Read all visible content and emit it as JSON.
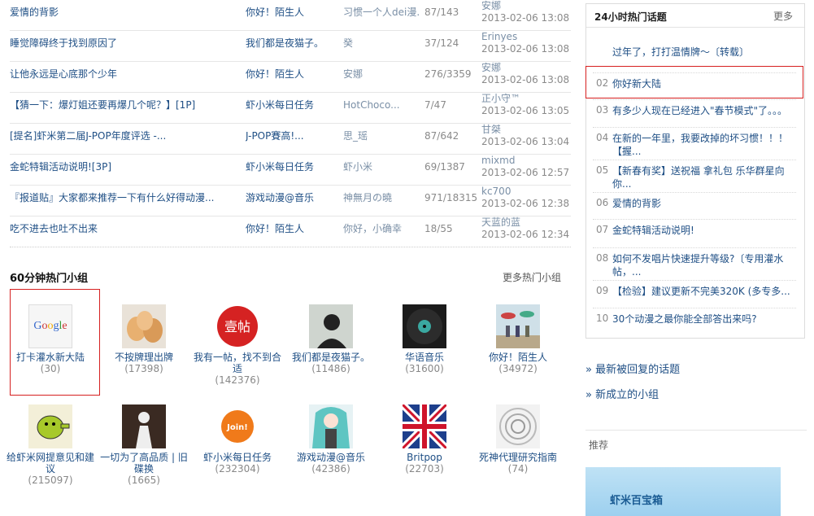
{
  "topics": [
    {
      "title": "爱情的背影",
      "group": "你好！陌生人",
      "author": "习惯一个人dei漫...",
      "count": "87/143",
      "last_user": "安娜",
      "last_time": "2013-02-06 13:08"
    },
    {
      "title": "睡觉障碍终于找到原因了",
      "group": "我们都是夜猫子。",
      "author": "癸",
      "count": "37/124",
      "last_user": "Erinyes",
      "last_time": "2013-02-06 13:08"
    },
    {
      "title": "让他永远是心底那个少年",
      "group": "你好！陌生人",
      "author": "安娜",
      "count": "276/3359",
      "last_user": "安娜",
      "last_time": "2013-02-06 13:08"
    },
    {
      "title": "【猜一下：爆灯姐还要再爆几个呢？】[1P]",
      "group": "虾小米每日任务",
      "author": "HotChoco...",
      "count": "7/47",
      "last_user": "正小守™",
      "last_time": "2013-02-06 13:05"
    },
    {
      "title": "[提名]虾米第二届J-POP年度评选 -...",
      "group": "J-POP賽高!...",
      "author": "思_瑶",
      "count": "87/642",
      "last_user": "甘桀",
      "last_time": "2013-02-06 13:04"
    },
    {
      "title": "金蛇特辑活动说明![3P]",
      "group": "虾小米每日任务",
      "author": "虾小米",
      "count": "69/1387",
      "last_user": "mixmd",
      "last_time": "2013-02-06 12:57"
    },
    {
      "title": "『报道贴』大家都来推荐一下有什么好得动漫...",
      "group": "游戏动漫@音乐",
      "author": "神無月の曉",
      "count": "971/18315",
      "last_user": "kc700",
      "last_time": "2013-02-06 12:38"
    },
    {
      "title": "吃不进去也吐不出来",
      "group": "你好！陌生人",
      "author": "你好，小确幸",
      "count": "18/55",
      "last_user": "天蓝的蓝",
      "last_time": "2013-02-06 12:34"
    }
  ],
  "groups_section": {
    "title": "60分钟热门小组",
    "more": "更多热门小组"
  },
  "groups": [
    {
      "name": "打卡灌水新大陆",
      "count": "(30)",
      "icon": "google-logo-icon",
      "logo_text": "Google"
    },
    {
      "name": "不按牌理出牌",
      "count": "(17398)",
      "icon": "eggs-icon"
    },
    {
      "name": "我有一帖，找不到合适",
      "count": "(142376)",
      "icon": "red-seal-icon",
      "logo_text": "壹帖"
    },
    {
      "name": "我们都是夜猫子。",
      "count": "(11486)",
      "icon": "person-silhouette-icon"
    },
    {
      "name": "华语音乐",
      "count": "(31600)",
      "icon": "vinyl-record-icon"
    },
    {
      "name": "你好！陌生人",
      "count": "(34972)",
      "icon": "people-umbrellas-icon"
    },
    {
      "name": "给虾米网提意见和建议",
      "count": "(215097)",
      "icon": "doodle-jump-icon"
    },
    {
      "name": "一切为了高品质 | 旧碟换",
      "count": "(1665)",
      "icon": "white-figure-icon"
    },
    {
      "name": "虾小米每日任务",
      "count": "(232304)",
      "icon": "join-badge-icon",
      "logo_text": "Join!"
    },
    {
      "name": "游戏动漫@音乐",
      "count": "(42386)",
      "icon": "miku-icon"
    },
    {
      "name": "Britpop",
      "count": "(22703)",
      "icon": "union-jack-icon"
    },
    {
      "name": "死神代理研究指南",
      "count": "(74)",
      "icon": "spiral-icon"
    }
  ],
  "hot_topics": {
    "title": "24小时热门话题",
    "more": "更多",
    "items": [
      {
        "num": "",
        "text": "过年了，打打温情牌～〔转载〕"
      },
      {
        "num": "02",
        "text": "你好新大陆"
      },
      {
        "num": "03",
        "text": "有多少人现在已经进入\"春节模式\"了。。。"
      },
      {
        "num": "04",
        "text": "在新的一年里，我要改掉的坏习惯！！！【握..."
      },
      {
        "num": "05",
        "text": "【新春有奖】送祝福 拿礼包 乐华群星向你..."
      },
      {
        "num": "06",
        "text": "爱情的背影"
      },
      {
        "num": "07",
        "text": "金蛇特辑活动说明!"
      },
      {
        "num": "08",
        "text": "如何不发唱片快速提升等级?〔专用灌水帖，..."
      },
      {
        "num": "09",
        "text": "【检验】建议更新不完美320K (多专多..."
      },
      {
        "num": "10",
        "text": "30个动漫之最你能全部答出来吗?"
      }
    ]
  },
  "side_links": {
    "latest_replied": "» 最新被回复的话题",
    "new_groups": "» 新成立的小组"
  },
  "recommend": {
    "label": "推荐",
    "toolbox": "虾米百宝箱"
  },
  "colors": {
    "link": "#1f4f85",
    "highlight_border": "#d62020"
  }
}
